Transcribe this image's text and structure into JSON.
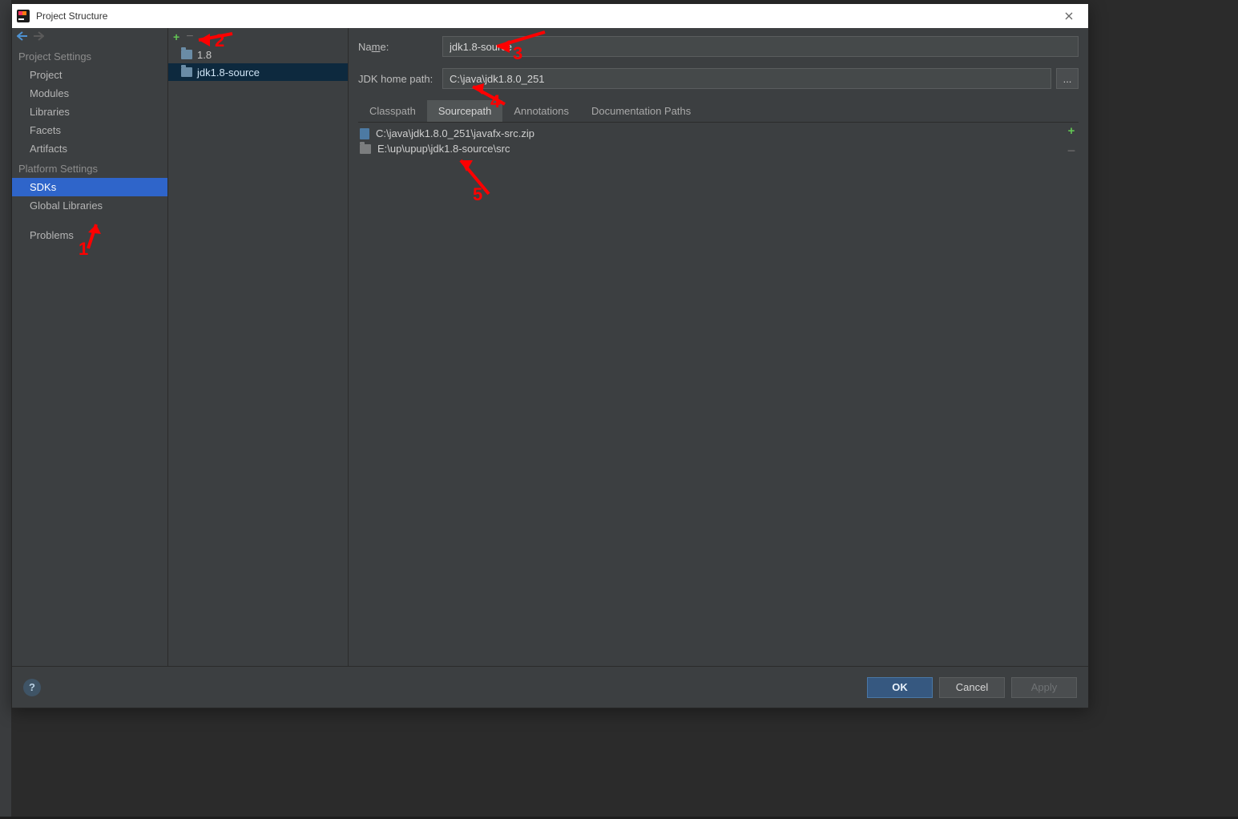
{
  "window": {
    "title": "Project Structure"
  },
  "nav": {
    "groups": [
      {
        "header": "Project Settings",
        "items": [
          "Project",
          "Modules",
          "Libraries",
          "Facets",
          "Artifacts"
        ]
      },
      {
        "header": "Platform Settings",
        "items": [
          "SDKs",
          "Global Libraries"
        ]
      }
    ],
    "problems_label": "Problems",
    "selected": "SDKs"
  },
  "sdk_list": {
    "items": [
      {
        "label": "1.8"
      },
      {
        "label": "jdk1.8-source"
      }
    ],
    "selected_index": 1
  },
  "detail": {
    "name_label_pre": "Na",
    "name_label_mnemonic": "m",
    "name_label_post": "e:",
    "name_value": "jdk1.8-source",
    "home_label": "JDK home path:",
    "home_value": "C:\\java\\jdk1.8.0_251",
    "browse": "...",
    "tabs": [
      "Classpath",
      "Sourcepath",
      "Annotations",
      "Documentation Paths"
    ],
    "active_tab": 1,
    "sources": [
      {
        "kind": "zip",
        "path": "C:\\java\\jdk1.8.0_251\\javafx-src.zip"
      },
      {
        "kind": "dir",
        "path": "E:\\up\\upup\\jdk1.8-source\\src"
      }
    ]
  },
  "footer": {
    "ok": "OK",
    "cancel": "Cancel",
    "apply": "Apply"
  },
  "annotations": [
    "1",
    "2",
    "3",
    "4",
    "5"
  ]
}
